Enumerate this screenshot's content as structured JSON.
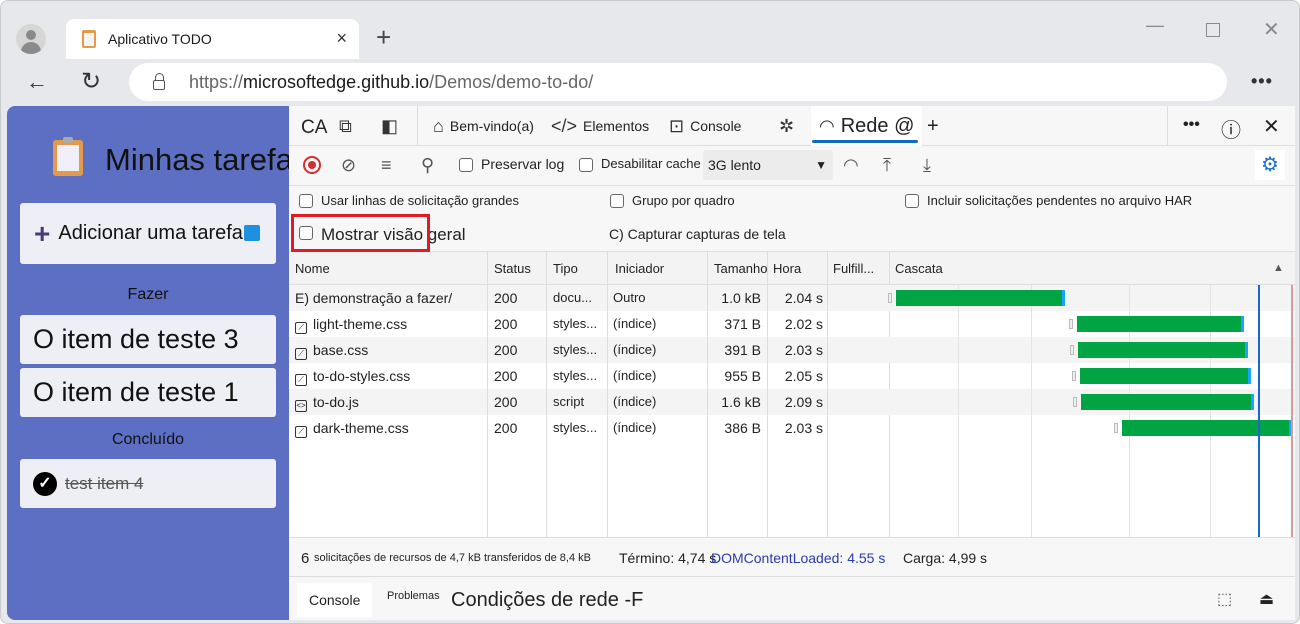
{
  "browser": {
    "tab_title": "Aplicativo TODO",
    "tab_close": "×",
    "new_tab": "+",
    "url_prefix": "https://",
    "url_host": "microsoftedge.github.io",
    "url_path": "/Demos/demo-to-do/",
    "more": "•••",
    "window_controls": {
      "minimize": "—",
      "close": "✕"
    },
    "nav": {
      "back": "←",
      "reload": "↻"
    }
  },
  "app": {
    "title": "Minhas tarefas",
    "add_task": "Adicionar uma tarefa",
    "todo_heading": "Fazer",
    "todo_items": [
      "O item de teste 3",
      "O item de teste 1"
    ],
    "done_heading": "Concluído",
    "done_items": [
      "test item 4"
    ]
  },
  "devtools": {
    "tabs": {
      "ca": "CA",
      "welcome": "Bem-vindo(a)",
      "elements": "Elementos",
      "console": "Console",
      "network": "Rede @",
      "add": "+"
    },
    "toolbar": {
      "preserve_log": "Preservar log",
      "disable_cache": "Desabilitar cache",
      "throttle": "3G lento"
    },
    "settings": {
      "large_rows": "Usar linhas de solicitação grandes",
      "group_by_frame": "Grupo por quadro",
      "include_pending_har": "Incluir solicitações pendentes no arquivo HAR",
      "show_overview": "Mostrar visão geral",
      "capture_screenshots": "C) Capturar capturas de tela"
    },
    "columns": [
      "Nome",
      "Status",
      "Tipo",
      "Iniciador",
      "Tamanho",
      "Hora",
      "Fulfill...",
      "Cascata"
    ],
    "requests": [
      {
        "icon": "document",
        "name": "E) demonstração a fazer/",
        "status": "200",
        "type": "docu...",
        "initiator": "Outro",
        "size": "1.0 kB",
        "time": "2.04 s",
        "wf_start": 0.02,
        "wf_end": 0.52
      },
      {
        "icon": "stylesheet",
        "name": "light-theme.css",
        "status": "200",
        "type": "styles...",
        "initiator": "(índice)",
        "size": "371 B",
        "time": "2.02 s",
        "wf_start": 0.555,
        "wf_end": 1.05
      },
      {
        "icon": "stylesheet",
        "name": "base.css",
        "status": "200",
        "type": "styles...",
        "initiator": "(índice)",
        "size": "391 B",
        "time": "2.03 s",
        "wf_start": 0.56,
        "wf_end": 1.06
      },
      {
        "icon": "stylesheet",
        "name": "to-do-styles.css",
        "status": "200",
        "type": "styles...",
        "initiator": "(índice)",
        "size": "955 B",
        "time": "2.05 s",
        "wf_start": 0.565,
        "wf_end": 1.07
      },
      {
        "icon": "script",
        "name": "to-do.js",
        "status": "200",
        "type": "script",
        "initiator": "(índice)",
        "size": "1.6 kB",
        "time": "2.09 s",
        "wf_start": 0.568,
        "wf_end": 1.08
      },
      {
        "icon": "stylesheet",
        "name": "dark-theme.css",
        "status": "200",
        "type": "styles...",
        "initiator": "(índice)",
        "size": "386 B",
        "time": "2.03 s",
        "wf_start": 0.69,
        "wf_end": 1.19
      }
    ],
    "summary": {
      "count": "6",
      "transferred": "solicitações de recursos de 4,7 kB transferidos de 8,4 kB",
      "finish": "Término: 4,74 s",
      "dcl": "DOMContentLoaded: 4.55 s",
      "load": "Carga: 4,99 s"
    },
    "drawer": {
      "console": "Console",
      "issues": "Problemas",
      "network_conditions": "Condições de rede -F"
    },
    "colors": {
      "accent": "#0f6cbd",
      "bar": "#00a442",
      "dcl": "#1a66d0",
      "highlight": "#e01b24"
    }
  }
}
